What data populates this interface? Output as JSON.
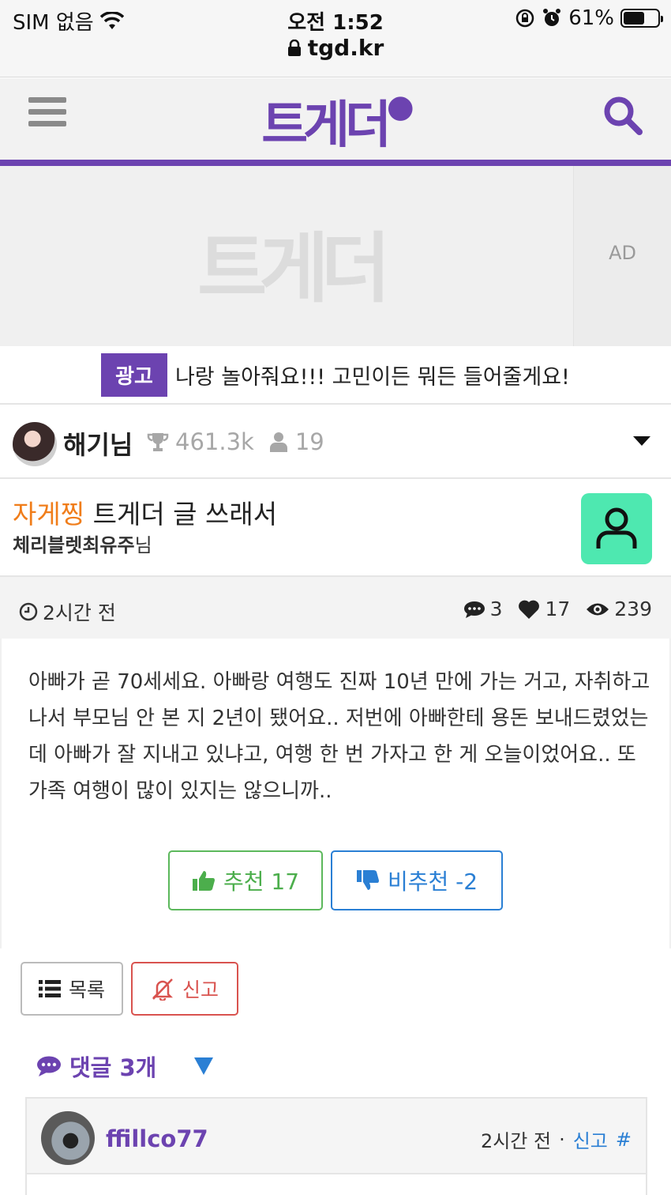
{
  "status": {
    "carrier": "SIM 없음",
    "time": "오전 1:52",
    "battery": "61%",
    "battery_level": 0.61,
    "url": "tgd.kr"
  },
  "header": {
    "logo": "트게더",
    "accent_color": "#6c43b0"
  },
  "ad": {
    "label": "AD",
    "watermark": "트게더"
  },
  "promo": {
    "badge": "광고",
    "text": "나랑 놀아줘요!!! 고민이든 뭐든 들어줄게요!"
  },
  "author": {
    "name": "해기님",
    "points": "461.3k",
    "followers": "19"
  },
  "post": {
    "category": "자게찡",
    "title": "트게더 글 쓰래서",
    "sub_bold": "체리블렛최유주",
    "sub_suffix": "님",
    "time": "2시간 전",
    "comments": "3",
    "likes": "17",
    "views": "239",
    "body": "아빠가 곧 70세세요. 아빠랑 여행도 진짜 10년 만에 가는 거고, 자취하고 나서 부모님 안 본 지 2년이 됐어요.. 저번에 아빠한테 용돈 보내드렸었는데 아빠가 잘 지내고 있냐고, 여행 한 번 가자고 한 게 오늘이었어요.. 또 가족 여행이 많이 있지는 않으니까..",
    "upvote_label": "추천 17",
    "downvote_label": "비추천 -2"
  },
  "actions": {
    "list_label": "목록",
    "report_label": "신고"
  },
  "comments": {
    "header": "댓글 3개",
    "items": [
      {
        "name": "ffillco77",
        "time": "2시간 전",
        "sep": "·",
        "report": "신고",
        "hash": "#"
      }
    ]
  }
}
